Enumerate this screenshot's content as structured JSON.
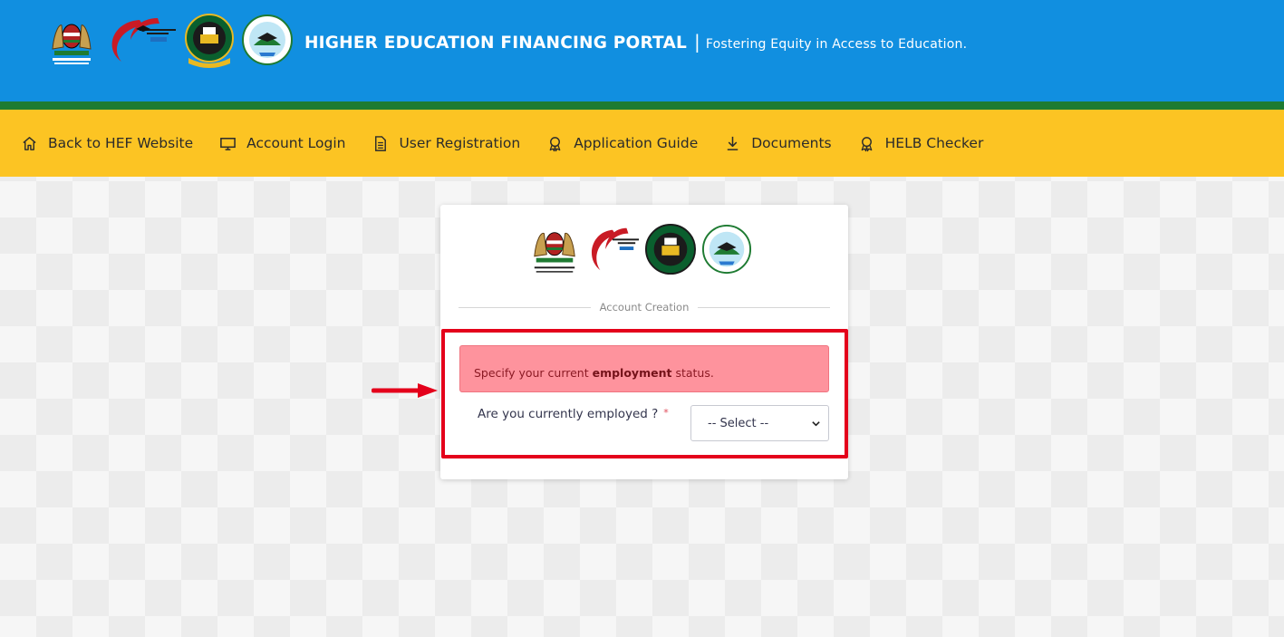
{
  "header": {
    "title": "HIGHER EDUCATION FINANCING PORTAL",
    "separator": "|",
    "tagline": "Fostering Equity in Access to Education.",
    "logos": [
      "kenya-coat-of-arms-logo",
      "ministry-of-education-logo",
      "helb-logo",
      "universities-fund-logo"
    ]
  },
  "nav": {
    "items": [
      {
        "label": "Back to HEF Website",
        "icon": "home-icon"
      },
      {
        "label": "Account Login",
        "icon": "monitor-icon"
      },
      {
        "label": "User Registration",
        "icon": "document-icon"
      },
      {
        "label": "Application Guide",
        "icon": "award-icon"
      },
      {
        "label": "Documents",
        "icon": "download-icon"
      },
      {
        "label": "HELB Checker",
        "icon": "award-icon"
      }
    ]
  },
  "card": {
    "section_label": "Account Creation",
    "alert": {
      "prefix": "Specify your current ",
      "emphasis": "employment",
      "suffix": " status."
    },
    "question": "Are you currently employed ?",
    "required_mark": "*",
    "select": {
      "value": "-- Select --"
    }
  },
  "colors": {
    "header_blue": "#118fe0",
    "header_green": "#1e7b32",
    "nav_yellow": "#fcc423",
    "alert_bg": "#fe939d",
    "highlight_red": "#e4001b"
  }
}
